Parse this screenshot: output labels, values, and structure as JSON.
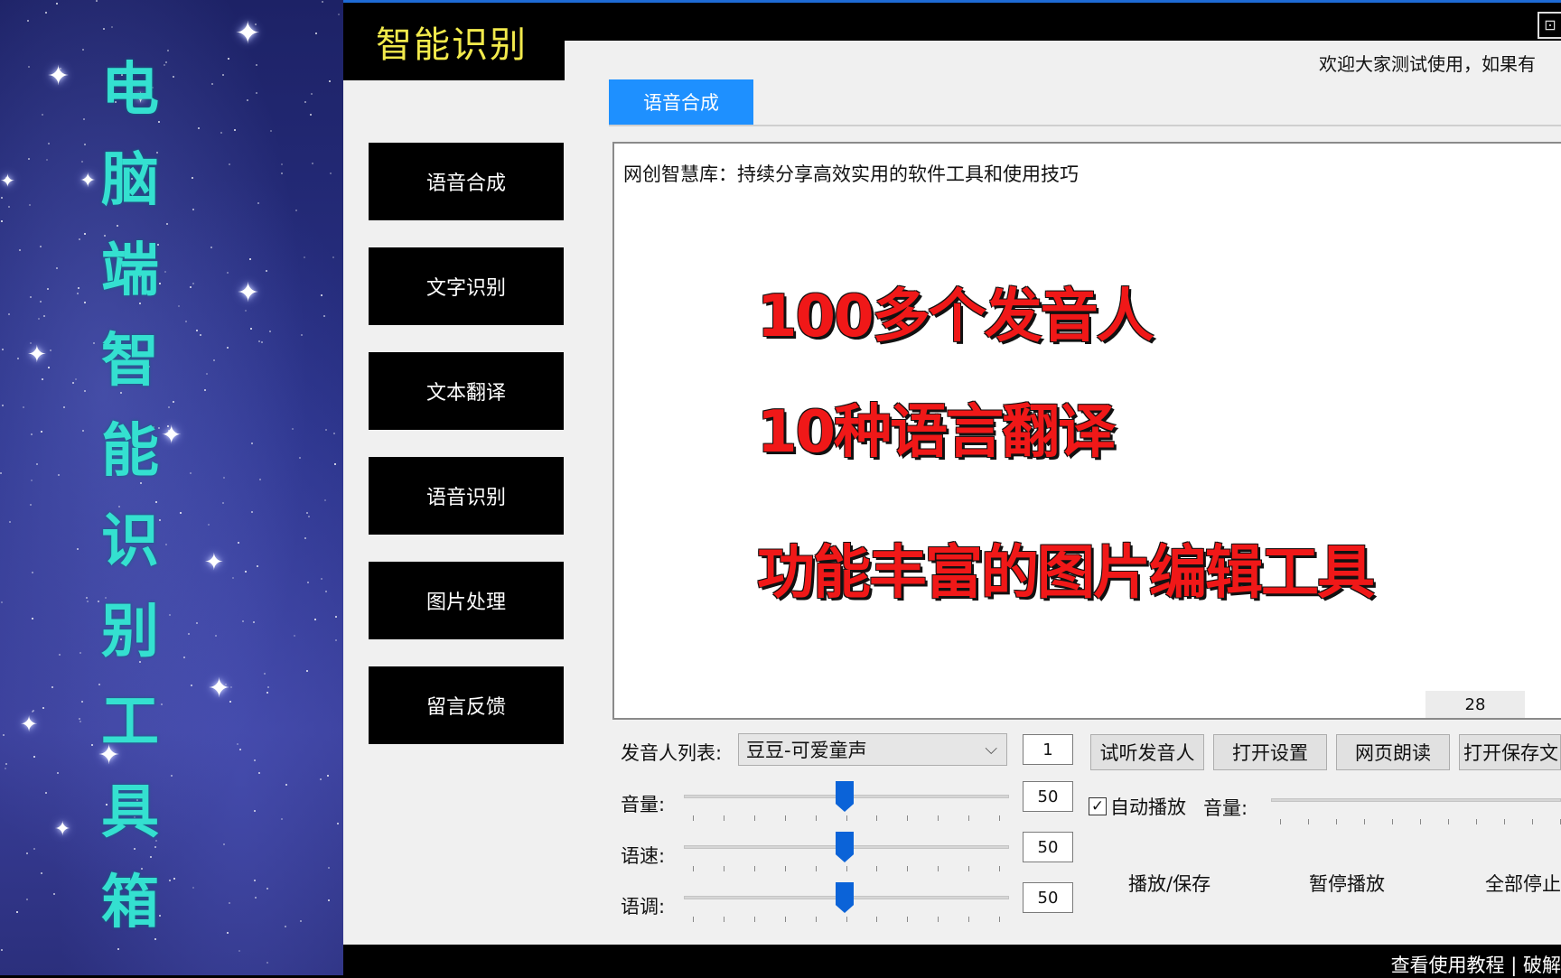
{
  "banner": {
    "title_chars": [
      "电",
      "脑",
      "端",
      "智",
      "能",
      "识",
      "别",
      "工",
      "具",
      "箱"
    ]
  },
  "app": {
    "title": "智能识别",
    "welcome": "欢迎大家测试使用，如果有"
  },
  "sidebar": {
    "items": [
      {
        "label": "语音合成"
      },
      {
        "label": "文字识别"
      },
      {
        "label": "文本翻译"
      },
      {
        "label": "语音识别"
      },
      {
        "label": "图片处理"
      },
      {
        "label": "留言反馈"
      }
    ]
  },
  "tabs": {
    "active": "语音合成"
  },
  "editor": {
    "text": "网创智慧库：持续分享高效实用的软件工具和使用技巧",
    "char_count": "28"
  },
  "overlay": {
    "line1": "100多个发音人",
    "line2": "10种语言翻译",
    "line3": "功能丰富的图片编辑工具"
  },
  "controls": {
    "voice_list_label": "发音人列表:",
    "voice_selected": "豆豆-可爱童声",
    "voice_count": "1",
    "preview_button": "试听发音人",
    "settings_button": "打开设置",
    "web_read_button": "网页朗读",
    "open_save_button": "打开保存文",
    "volume_label": "音量:",
    "volume_value": "50",
    "speed_label": "语速:",
    "speed_value": "50",
    "pitch_label": "语调:",
    "pitch_value": "50",
    "auto_play_label": "自动播放",
    "auto_play_checked": true,
    "playback_volume_label": "音量:",
    "play_save": "播放/保存",
    "pause": "暂停播放",
    "stop_all": "全部停止"
  },
  "footer": {
    "links": "查看使用教程 | 破解"
  },
  "colors": {
    "banner_text": "#34e0d0",
    "app_title": "#f2ea4c",
    "tab_active": "#1e90ff",
    "promo_red": "#f01818",
    "slider_thumb": "#0b63d8"
  }
}
